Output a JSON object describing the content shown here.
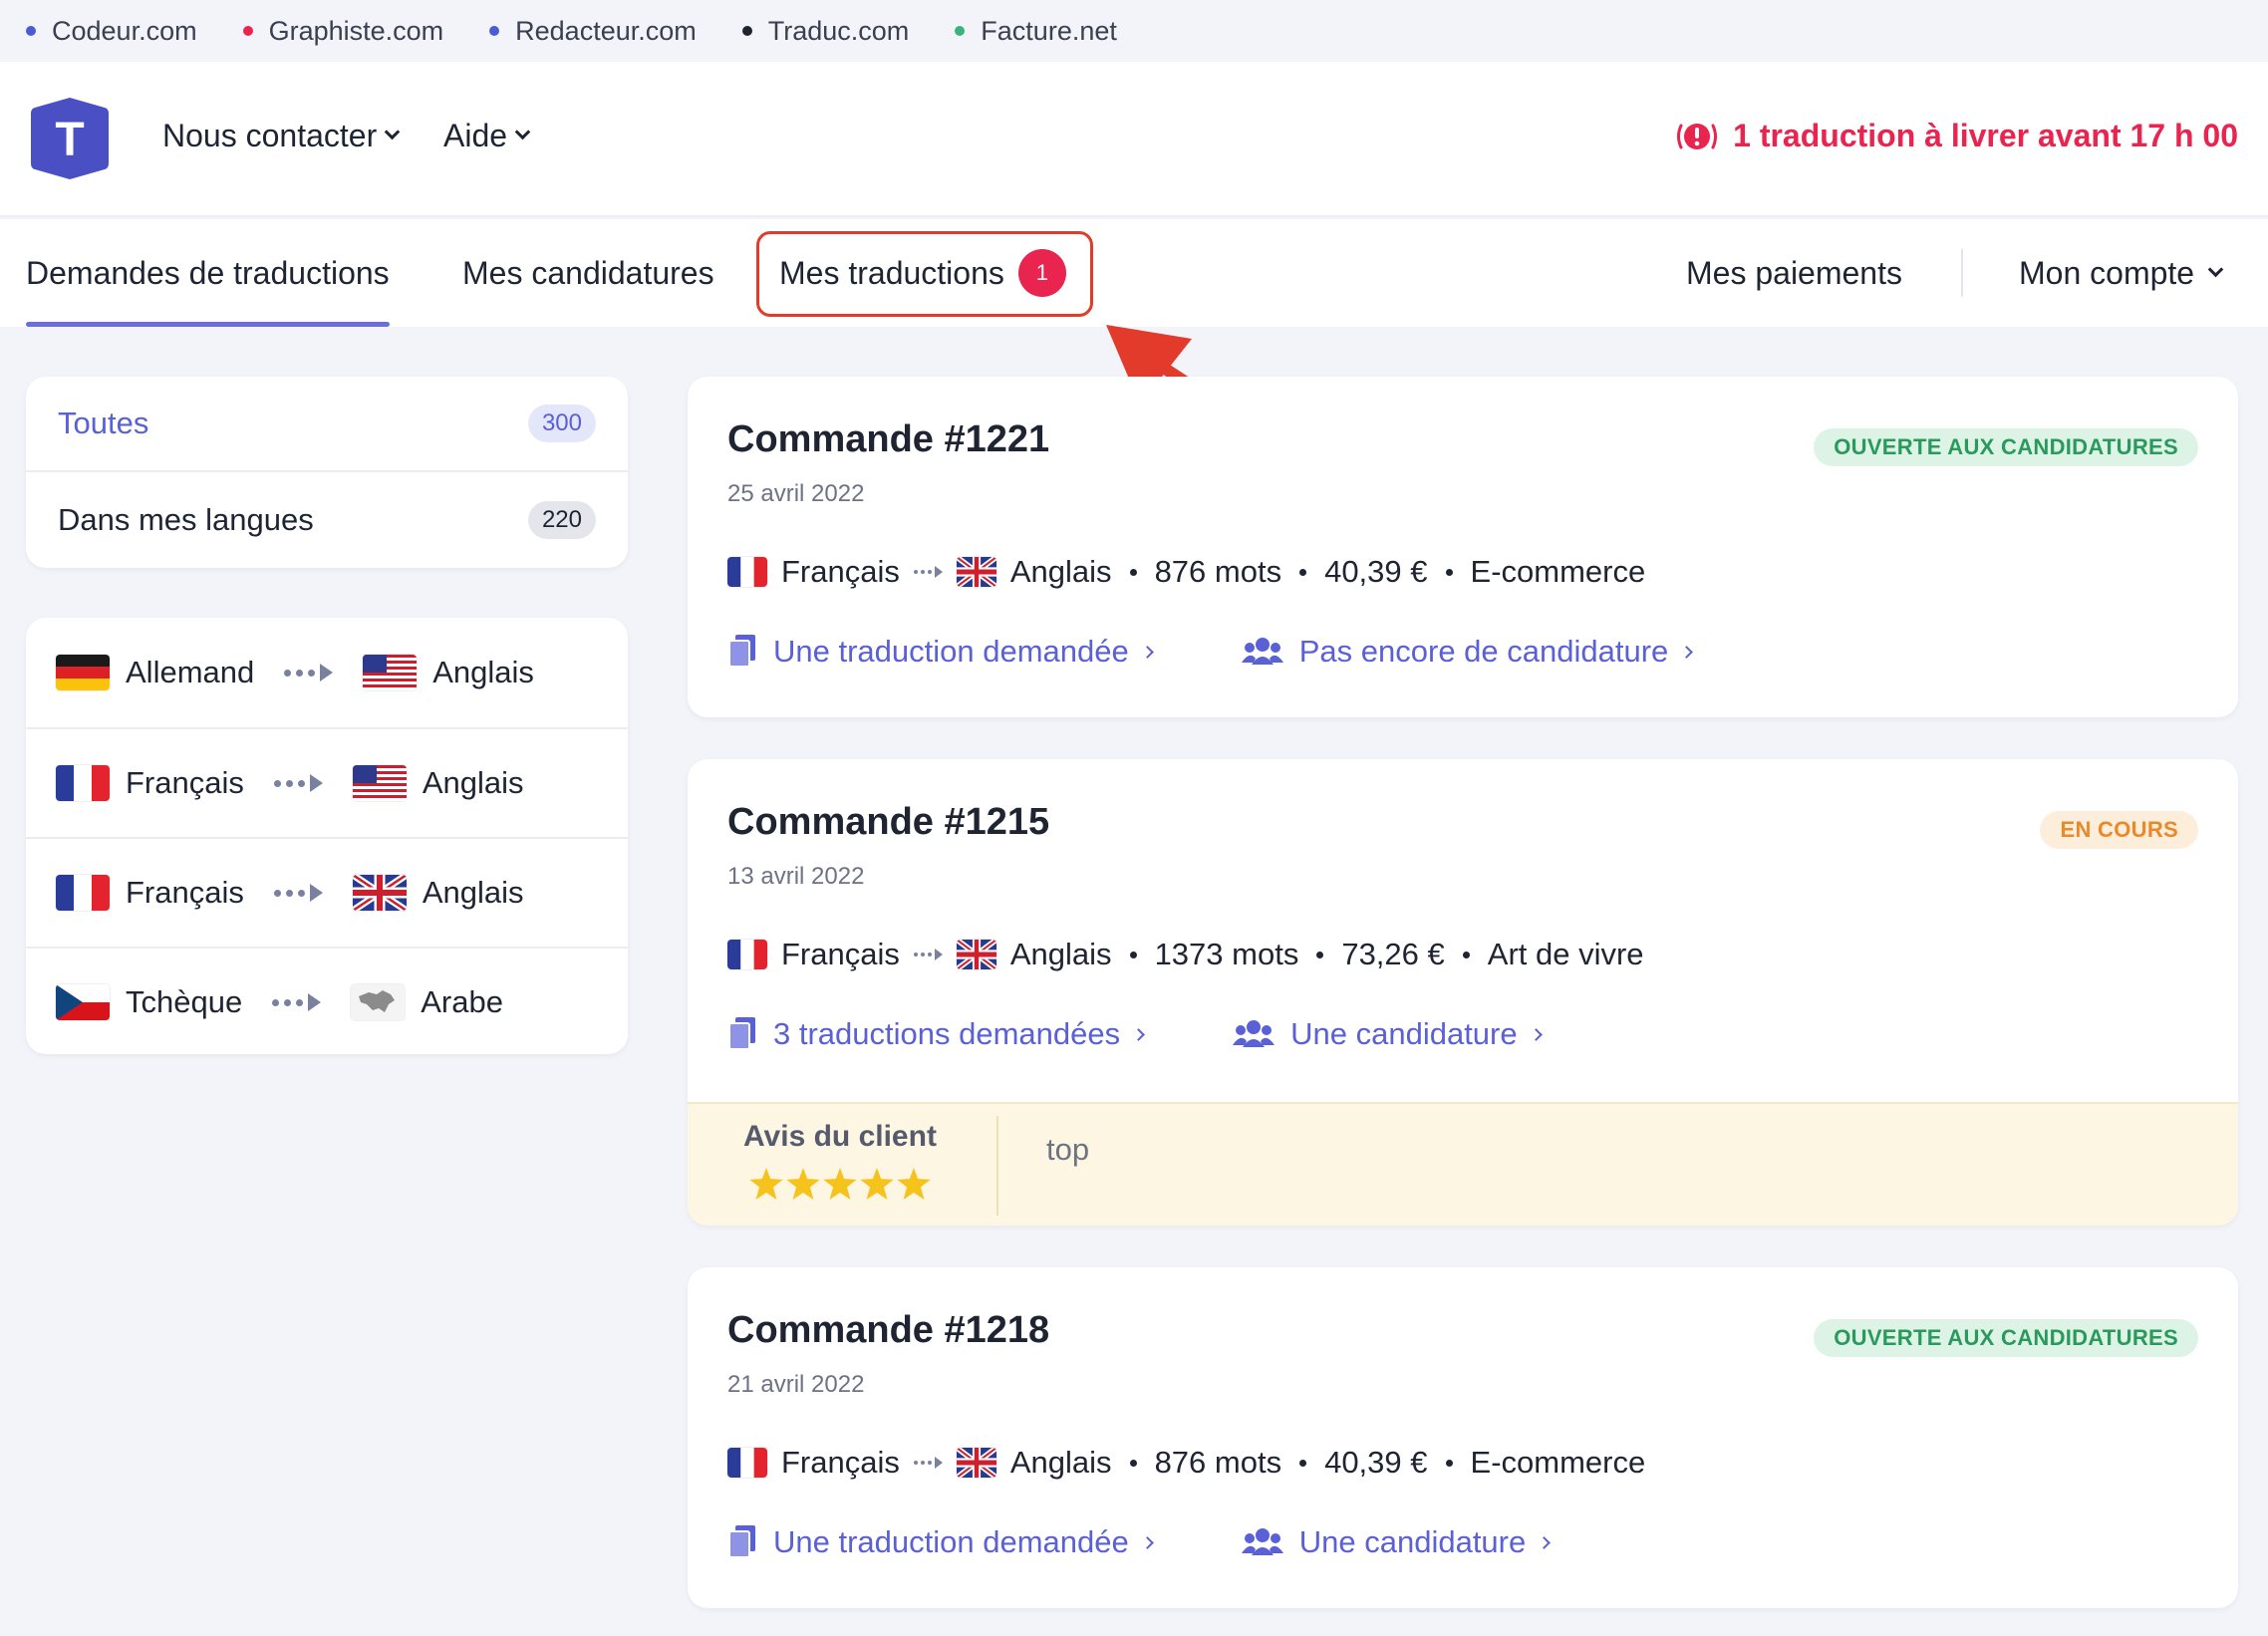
{
  "network": [
    {
      "label": "Codeur.com",
      "color": "#4a5bd6"
    },
    {
      "label": "Graphiste.com",
      "color": "#e8244f"
    },
    {
      "label": "Redacteur.com",
      "color": "#4a5bd6"
    },
    {
      "label": "Traduc.com",
      "color": "#1f2433"
    },
    {
      "label": "Facture.net",
      "color": "#3ab37a"
    }
  ],
  "header": {
    "logo_letter": "T",
    "menu": [
      {
        "label": "Nous contacter"
      },
      {
        "label": "Aide"
      }
    ],
    "alert": "1 traduction à livrer avant 17 h 00"
  },
  "tabs": {
    "demandes": "Demandes de traductions",
    "candidatures": "Mes candidatures",
    "traductions": "Mes traductions",
    "traductions_badge": "1",
    "paiements": "Mes paiements",
    "compte": "Mon compte"
  },
  "filters": [
    {
      "label": "Toutes",
      "count": "300"
    },
    {
      "label": "Dans mes langues",
      "count": "220"
    }
  ],
  "language_pairs": [
    {
      "from": "Allemand",
      "to": "Anglais"
    },
    {
      "from": "Français",
      "to": "Anglais"
    },
    {
      "from": "Français",
      "to": "Anglais"
    },
    {
      "from": "Tchèque",
      "to": "Arabe"
    }
  ],
  "orders": [
    {
      "title": "Commande #1221",
      "date": "25 avril 2022",
      "status": "OUVERTE AUX CANDIDATURES",
      "from": "Français",
      "to": "Anglais",
      "words": "876 mots",
      "price": "40,39 €",
      "category": "E-commerce",
      "requests": "Une traduction demandée",
      "applications": "Pas encore de candidature"
    },
    {
      "title": "Commande #1215",
      "date": "13 avril 2022",
      "status": "EN COURS",
      "from": "Français",
      "to": "Anglais",
      "words": "1373 mots",
      "price": "73,26 €",
      "category": "Art de vivre",
      "requests": "3 traductions demandées",
      "applications": "Une candidature",
      "review_label": "Avis du client",
      "review_text": "top",
      "review_stars": 5
    },
    {
      "title": "Commande #1218",
      "date": "21 avril 2022",
      "status": "OUVERTE AUX CANDIDATURES",
      "from": "Français",
      "to": "Anglais",
      "words": "876 mots",
      "price": "40,39 €",
      "category": "E-commerce",
      "requests": "Une traduction demandée",
      "applications": "Une candidature"
    }
  ],
  "colors": {
    "accent": "#5a60d6",
    "alert": "#e8244f",
    "annotation": "#e23a2b"
  }
}
